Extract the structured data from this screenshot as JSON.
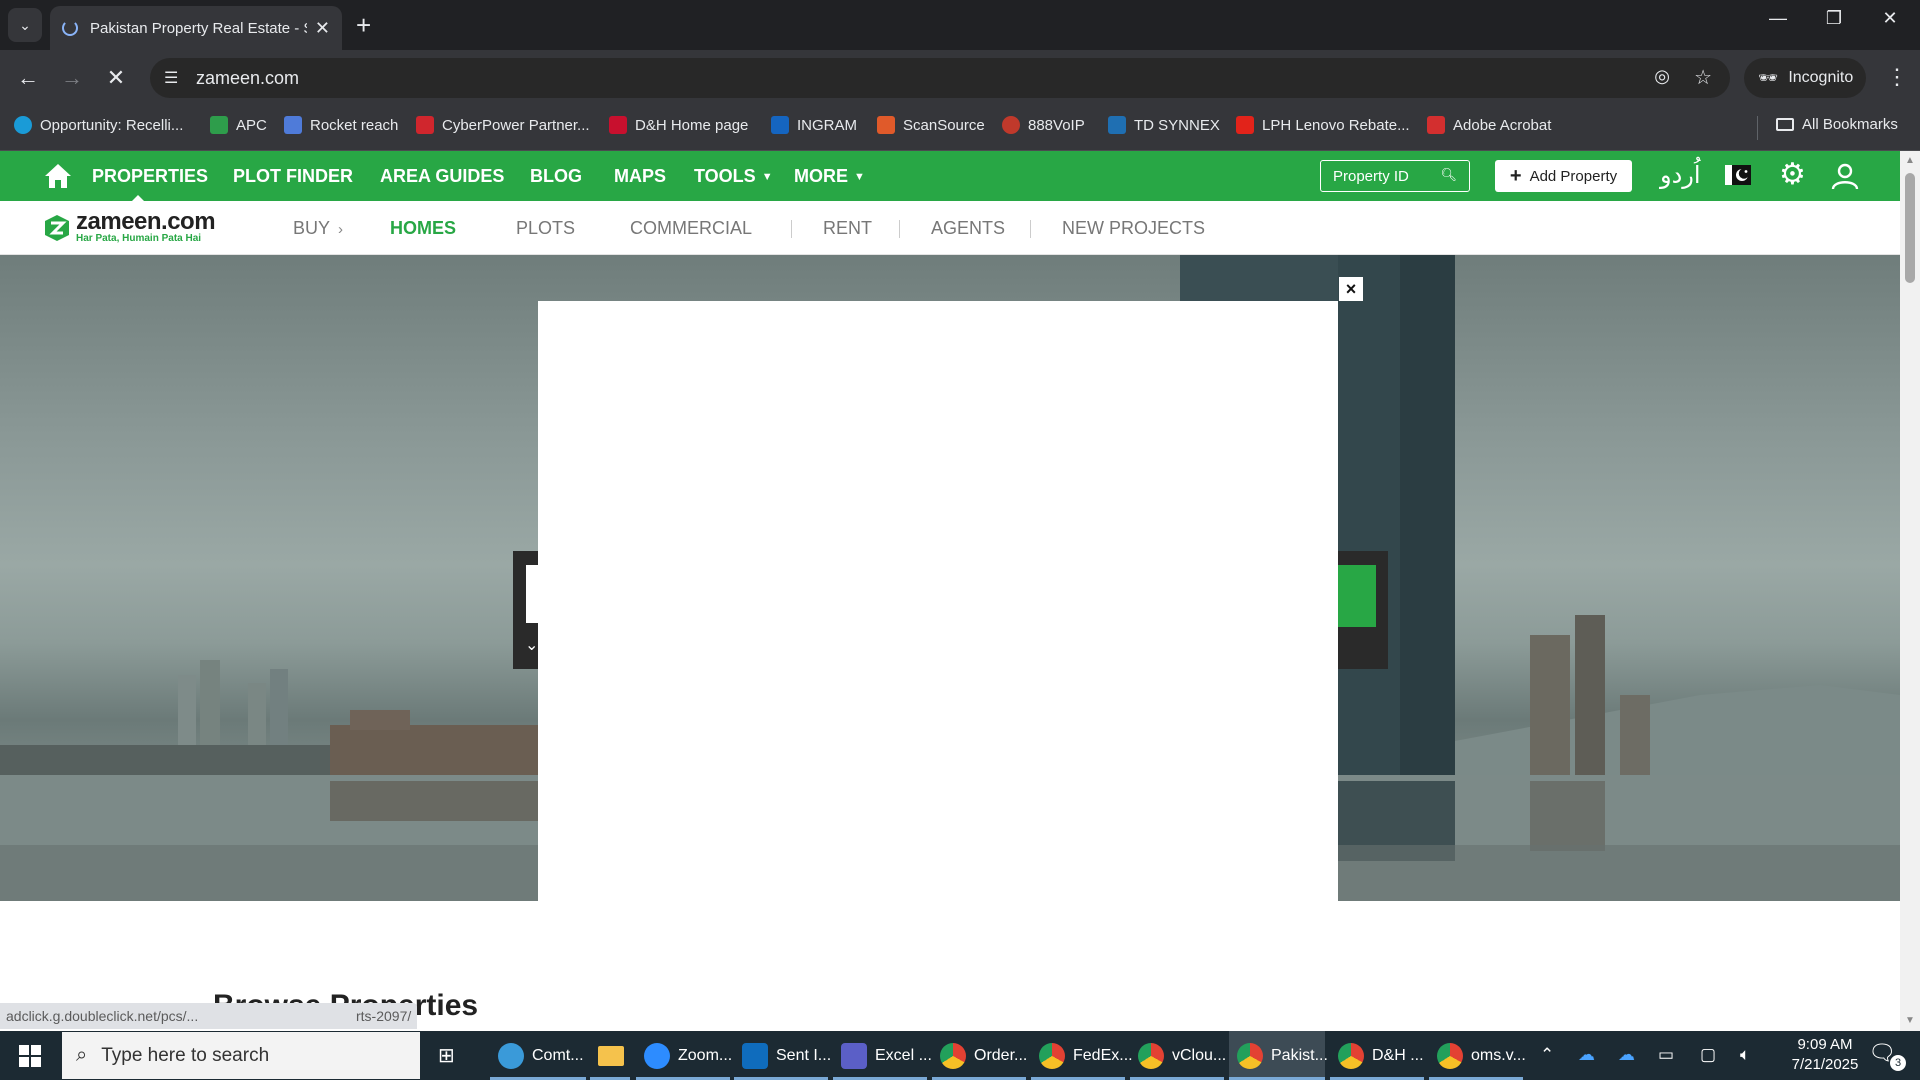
{
  "browser": {
    "tab_title": "Pakistan Property Real Estate - S",
    "url": "zameen.com",
    "incognito_label": "Incognito",
    "bookmarks": [
      {
        "label": "Opportunity: Recelli...",
        "color": "#1a9bd7"
      },
      {
        "label": "APC",
        "color": "#2e9d4b"
      },
      {
        "label": "Rocket reach",
        "color": "#4f7bd9"
      },
      {
        "label": "CyberPower Partner...",
        "color": "#d0262d"
      },
      {
        "label": "D&H Home page",
        "color": "#c8102e"
      },
      {
        "label": "INGRAM",
        "color": "#1565c0"
      },
      {
        "label": "ScanSource",
        "color": "#e05a2a"
      },
      {
        "label": "888VoIP",
        "color": "#c0392b"
      },
      {
        "label": "TD SYNNEX",
        "color": "#1f6fb2"
      },
      {
        "label": "LPH Lenovo Rebate...",
        "color": "#e2231a"
      },
      {
        "label": "Adobe Acrobat",
        "color": "#d32f2f"
      }
    ],
    "all_bookmarks_label": "All Bookmarks"
  },
  "site": {
    "brand_color": "#28a745",
    "top_nav": {
      "properties": "PROPERTIES",
      "plot_finder": "PLOT FINDER",
      "area_guides": "AREA GUIDES",
      "blog": "BLOG",
      "maps": "MAPS",
      "tools": "TOOLS",
      "more": "MORE",
      "property_id_placeholder": "Property ID",
      "add_property": "Add Property",
      "urdu_label": "اُردو"
    },
    "logo": {
      "name": "zameen.com",
      "tagline": "Har Pata, Humain Pata Hai"
    },
    "sub_nav": {
      "buy": "BUY",
      "homes": "HOMES",
      "plots": "PLOTS",
      "commercial": "COMMERCIAL",
      "rent": "RENT",
      "agents": "AGENTS",
      "new_projects": "NEW PROJECTS"
    },
    "modal_close": "×",
    "browse_heading": "Browse Properties",
    "status_url_left": "adclick.g.doubleclick.net/pcs/...",
    "status_url_right": "rts-2097/"
  },
  "taskbar": {
    "search_placeholder": "Type here to search",
    "apps": [
      {
        "label": "Comt...",
        "color": "#3a9ad9"
      },
      {
        "label": "Zoom...",
        "color": "#2d8cff"
      },
      {
        "label": "Sent I...",
        "color": "#0f6cbd"
      },
      {
        "label": "Excel ...",
        "color": "#5b5fc7"
      },
      {
        "label": "Order...",
        "color": "#e34133"
      },
      {
        "label": "FedEx...",
        "color": "#e34133"
      },
      {
        "label": "vClou...",
        "color": "#e34133"
      },
      {
        "label": "Pakist...",
        "color": "#e34133"
      },
      {
        "label": "D&H ...",
        "color": "#e34133"
      },
      {
        "label": "oms.v...",
        "color": "#e34133"
      }
    ],
    "time": "9:09 AM",
    "date": "7/21/2025",
    "notification_count": "3"
  }
}
